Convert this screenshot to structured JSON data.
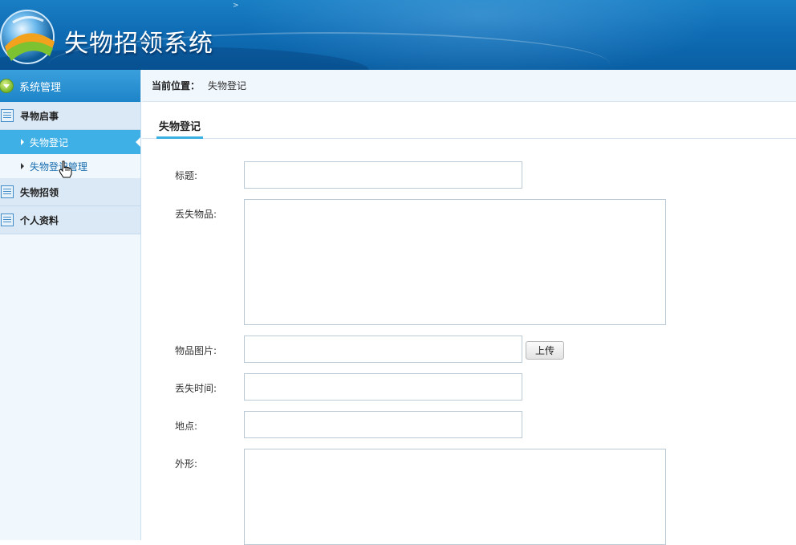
{
  "header": {
    "app_title": "失物招领系统",
    "top_mark": ">"
  },
  "sidebar": {
    "system_header": "系统管理",
    "groups": [
      {
        "label": "寻物启事",
        "items": [
          {
            "label": "失物登记",
            "active": true
          },
          {
            "label": "失物登记管理",
            "active": false
          }
        ]
      },
      {
        "label": "失物招领",
        "items": []
      },
      {
        "label": "个人资料",
        "items": []
      }
    ]
  },
  "breadcrumb": {
    "label": "当前位置：",
    "current": "失物登记"
  },
  "tab": {
    "label": "失物登记"
  },
  "form": {
    "title_label": "标题:",
    "title_value": "",
    "lost_item_label": "丢失物品:",
    "lost_item_value": "",
    "image_label": "物品图片:",
    "image_value": "",
    "upload_label": "上传",
    "time_label": "丢失时间:",
    "time_value": "",
    "location_label": "地点:",
    "location_value": "",
    "appearance_label": "外形:",
    "appearance_value": ""
  },
  "colors": {
    "header_blue": "#0f6db5",
    "sidebar_bg": "#f0f7fd",
    "active_item": "#3fb0e6",
    "tab_underline": "#3ab0e2"
  }
}
